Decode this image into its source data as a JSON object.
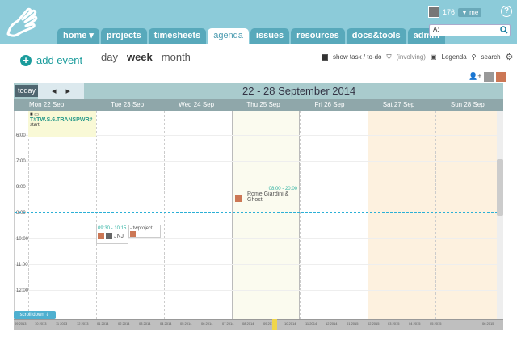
{
  "header": {
    "nav_tabs": [
      {
        "label": "home ▾",
        "active": false
      },
      {
        "label": "projects",
        "active": false
      },
      {
        "label": "timesheets",
        "active": false
      },
      {
        "label": "agenda",
        "active": true
      },
      {
        "label": "issues",
        "active": false
      },
      {
        "label": "resources",
        "active": false
      },
      {
        "label": "docs&tools",
        "active": false
      },
      {
        "label": "admin",
        "active": false
      }
    ],
    "user_count": "176",
    "me_label": "▼ me",
    "search_value": "A:",
    "help": "?"
  },
  "toolbar": {
    "add_event_label": "add event",
    "views": [
      "day",
      "week",
      "month"
    ],
    "active_view": "week",
    "show_task_label": "show task / to-do",
    "involving_label": "(involving)",
    "legenda_label": "Legenda",
    "search_label": "search"
  },
  "calendar": {
    "today_label": "today",
    "prev_arrow": "◀",
    "next_arrow": "▶",
    "range_title": "22 - 28 September 2014",
    "days": [
      "Mon 22 Sep",
      "Tue 23 Sep",
      "Wed 24 Sep",
      "Thu 25 Sep",
      "Fri 26 Sep",
      "Sat 27 Sep",
      "Sun 28 Sep"
    ],
    "hours": [
      "6:00",
      "7:00",
      "8:00",
      "9:00",
      "10:00",
      "11:00",
      "12:00"
    ],
    "events": {
      "top_event_code": "T#TW.S.6.TRANSPWR#",
      "top_event_sub": "start",
      "rome_time": "08:00 - 20:00",
      "rome_title": "Rome Giardini & Ghost",
      "jnj_time": "09:30 - 10:15",
      "jnj_title": "JNJ",
      "tw_title": "- twproject..."
    },
    "scroll_down_label": "scroll down ⇓"
  },
  "timeline": {
    "labels": [
      "09 2013",
      "10 2013",
      "11 2013",
      "12 2013",
      "01 2014",
      "02 2014",
      "03 2014",
      "04 2014",
      "05 2014",
      "06 2014",
      "07 2014",
      "08 2014",
      "09 2014",
      "10 2014",
      "11 2014",
      "12 2014",
      "01 2015",
      "02 2015",
      "03 2015",
      "04 2015",
      "05 2015",
      "06 2015"
    ]
  },
  "colors": {
    "header_bg": "#8ccbd9",
    "tab_bg": "#58a9bb",
    "accent": "#1b9c9c",
    "now_line": "#2bb0d6",
    "weekend": "#fdf1df"
  }
}
